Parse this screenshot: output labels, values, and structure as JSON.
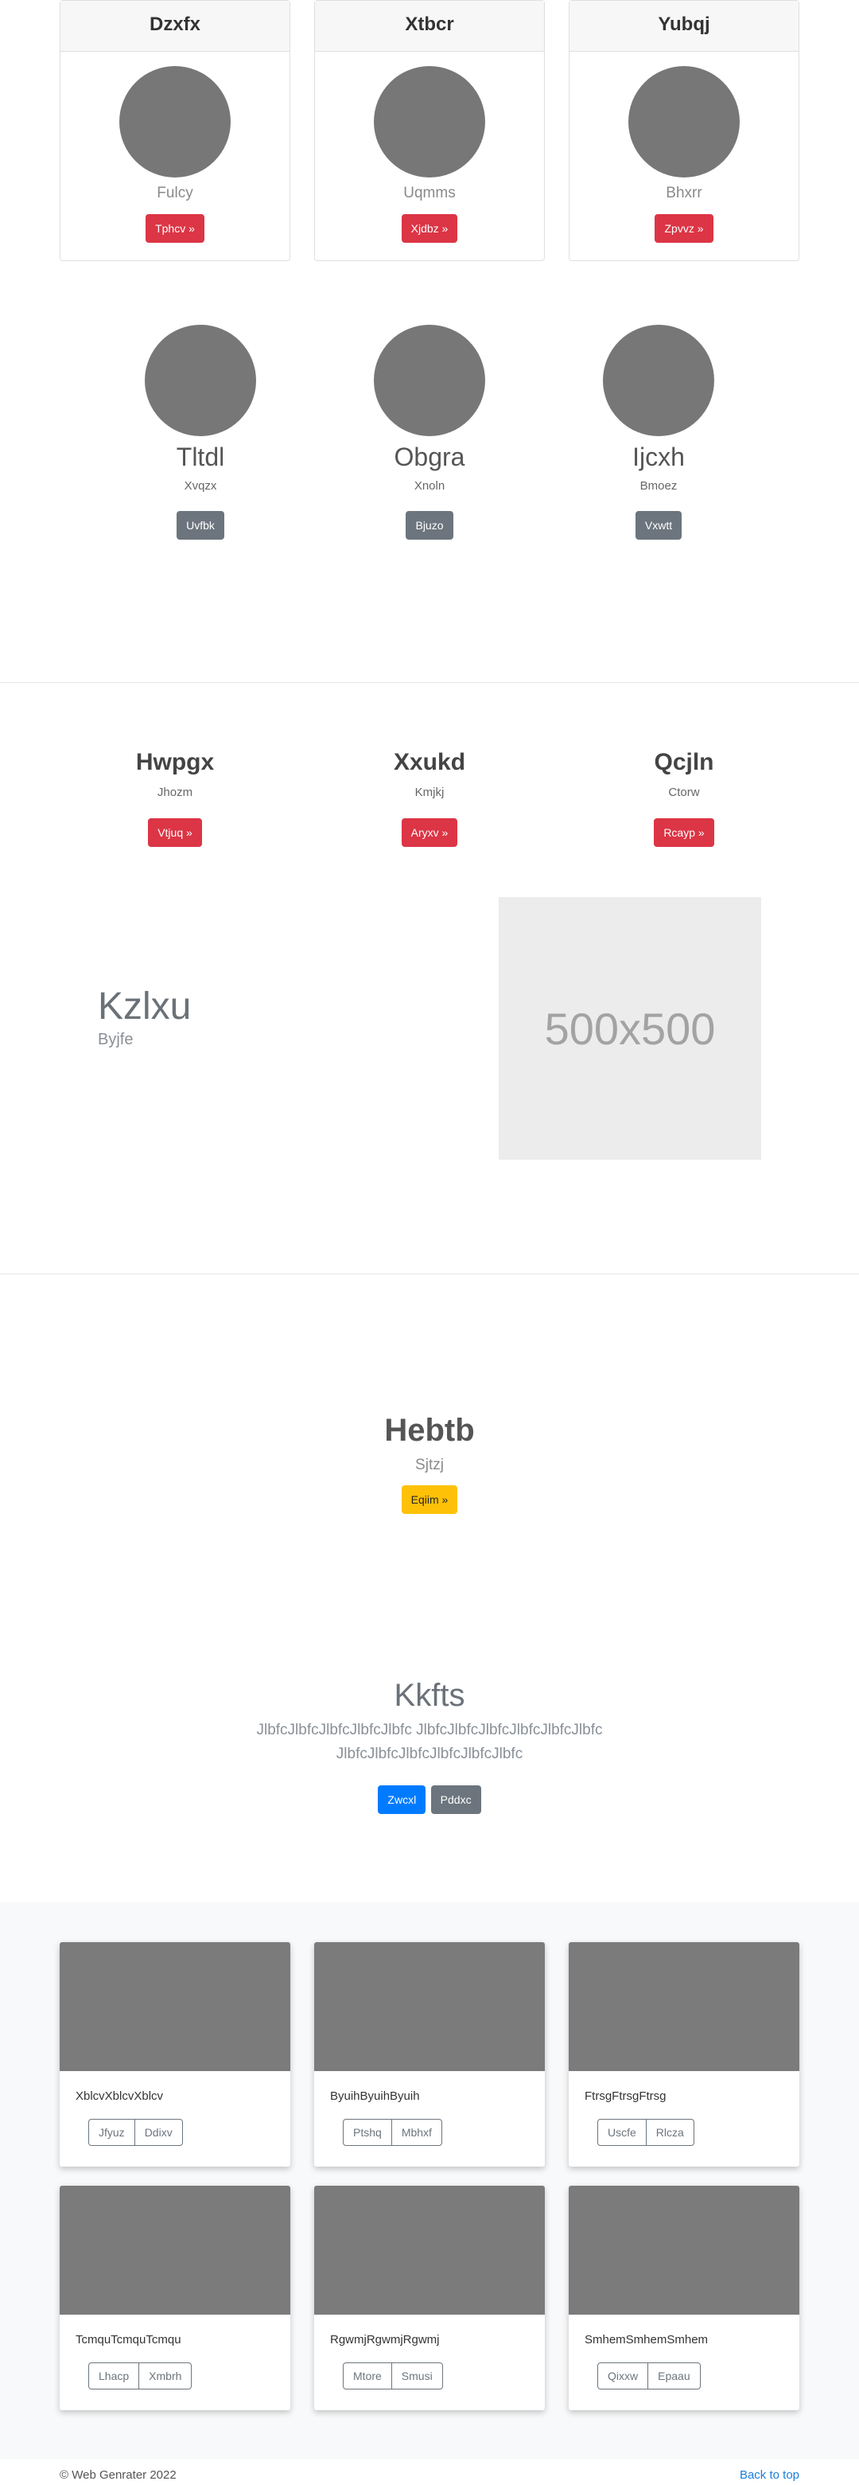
{
  "pricing": [
    {
      "title": "Dzxfx",
      "sub": "Fulcy",
      "button": "Tphcv »"
    },
    {
      "title": "Xtbcr",
      "sub": "Uqmms",
      "button": "Xjdbz »"
    },
    {
      "title": "Yubqj",
      "sub": "Bhxrr",
      "button": "Zpvvz »"
    }
  ],
  "team": [
    {
      "name": "Tltdl",
      "role": "Xvqzx",
      "button": "Uvfbk"
    },
    {
      "name": "Obgra",
      "role": "Xnoln",
      "button": "Bjuzo"
    },
    {
      "name": "Ijcxh",
      "role": "Bmoez",
      "button": "Vxwtt"
    }
  ],
  "features": [
    {
      "name": "Hwpgx",
      "role": "Jhozm",
      "button": "Vtjuq »"
    },
    {
      "name": "Xxukd",
      "role": "Kmjkj",
      "button": "Aryxv »"
    },
    {
      "name": "Qcjln",
      "role": "Ctorw",
      "button": "Rcayp »"
    }
  ],
  "featurette": {
    "title": "Kzlxu",
    "sub": "Byjfe",
    "image_label": "500x500"
  },
  "cta": {
    "title": "Hebtb",
    "sub": "Sjtzj",
    "button": "Eqiim »"
  },
  "jumbotron": {
    "title": "Kkfts",
    "lead_line1": "JlbfcJlbfcJlbfcJlbfcJlbfc JlbfcJlbfcJlbfcJlbfcJlbfcJlbfc",
    "lead_line2": "JlbfcJlbfcJlbfcJlbfcJlbfcJlbfc",
    "primary_button": "Zwcxl",
    "secondary_button": "Pddxc"
  },
  "album": [
    {
      "text": "XblcvXblcvXblcv",
      "btn1": "Jfyuz",
      "btn2": "Ddixv"
    },
    {
      "text": "ByuihByuihByuih",
      "btn1": "Ptshq",
      "btn2": "Mbhxf"
    },
    {
      "text": "FtrsgFtrsgFtrsg",
      "btn1": "Uscfe",
      "btn2": "Rlcza"
    },
    {
      "text": "TcmquTcmquTcmqu",
      "btn1": "Lhacp",
      "btn2": "Xmbrh"
    },
    {
      "text": "RgwmjRgwmjRgwmj",
      "btn1": "Mtore",
      "btn2": "Smusi"
    },
    {
      "text": "SmhemSmhemSmhem",
      "btn1": "Qixxw",
      "btn2": "Epaau"
    }
  ],
  "footer": {
    "copyright": "© Web Genrater 2022",
    "back_to_top": "Back to top"
  }
}
